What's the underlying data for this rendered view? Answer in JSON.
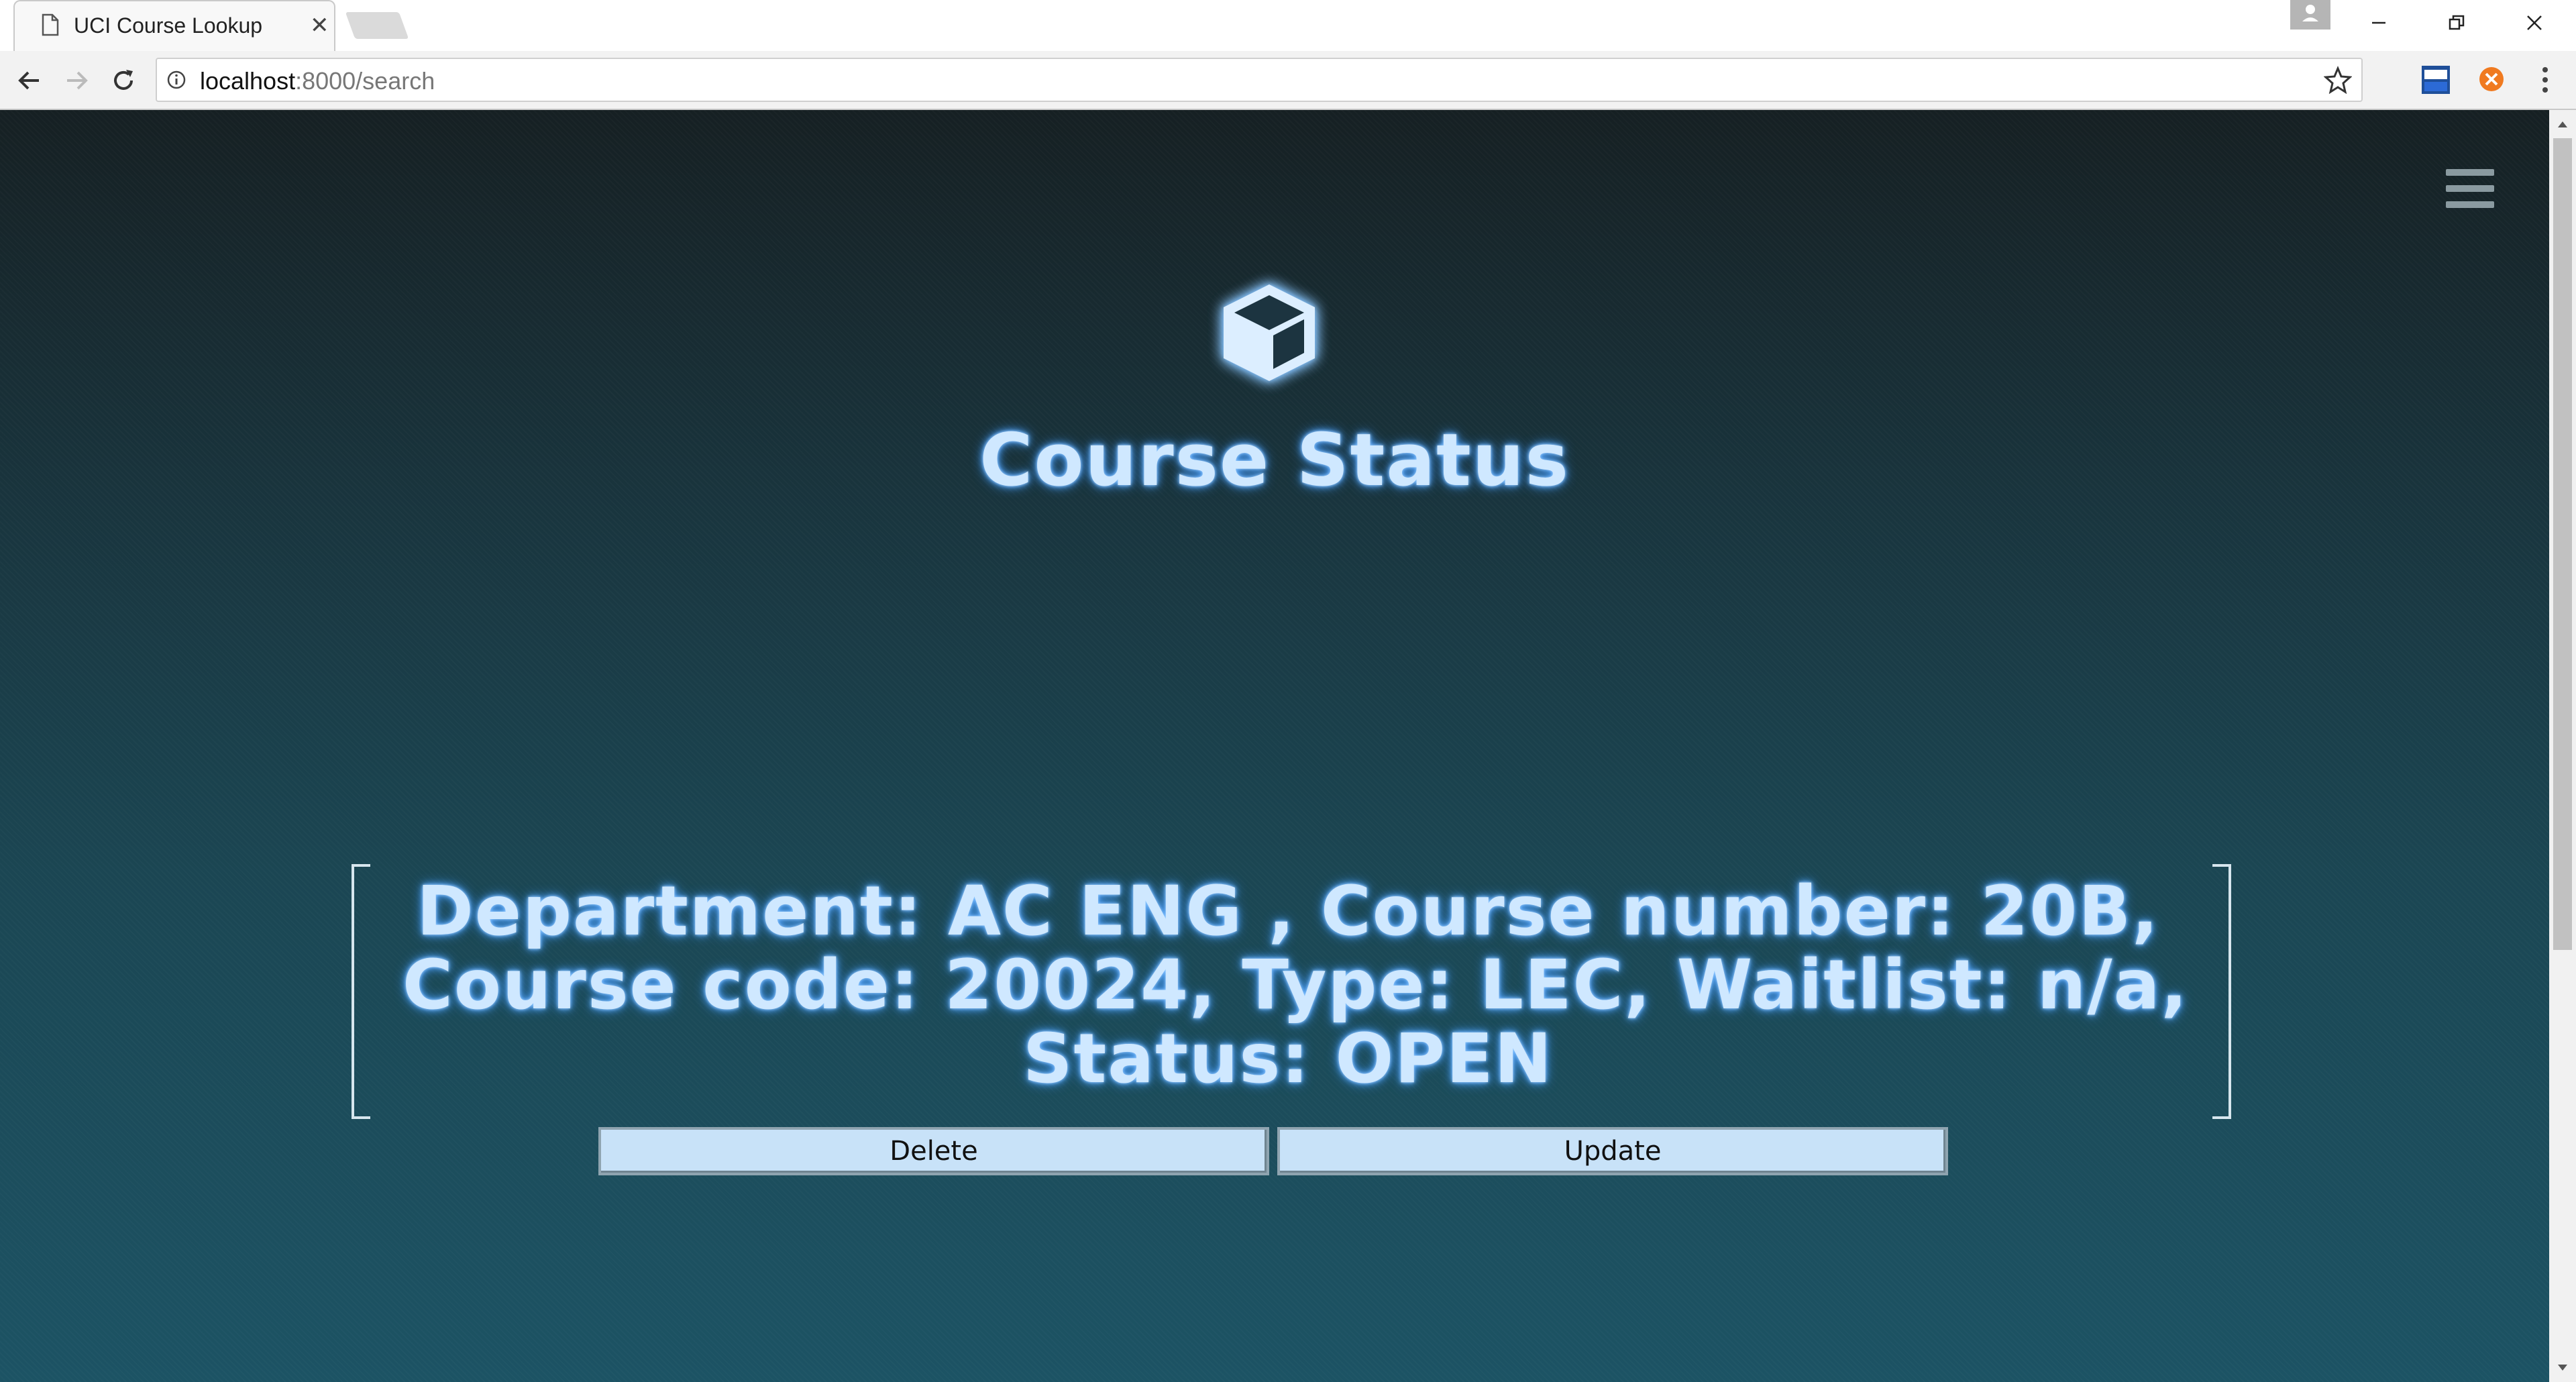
{
  "browser": {
    "tab_title": "UCI Course Lookup",
    "url_host": "localhost",
    "url_path": ":8000/search"
  },
  "page": {
    "title": "Course Status",
    "result_lines": [
      "Department: AC ENG , Course number: 20B,",
      "Course code: 20024, Type: LEC, Waitlist: n/a,",
      "Status: OPEN"
    ],
    "delete_label": "Delete",
    "update_label": "Update"
  },
  "icons": {
    "logo": "cube-icon",
    "menu": "hamburger-menu-icon"
  },
  "colors": {
    "glow_text": "#cfe8ff",
    "button_bg": "#c8e2f8",
    "page_bg_top": "#162023",
    "page_bg_bottom": "#1c5364"
  }
}
